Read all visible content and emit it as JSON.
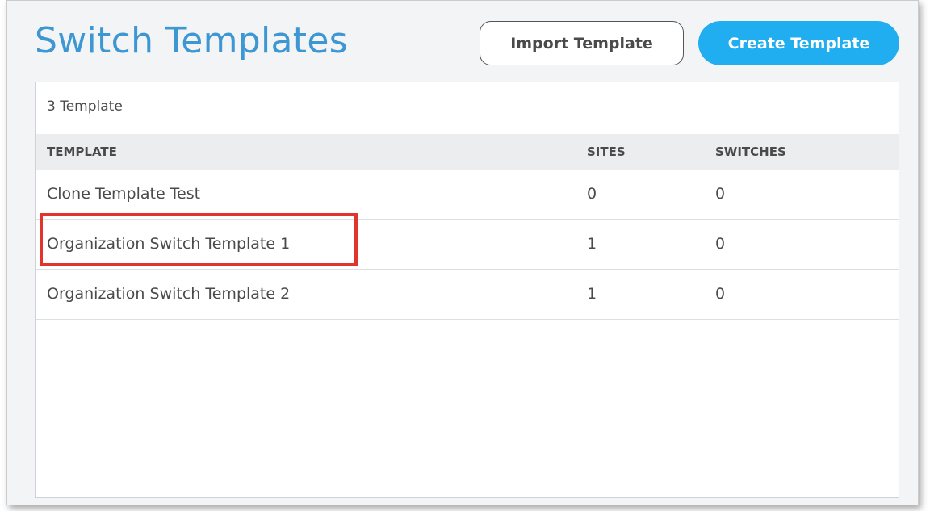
{
  "header": {
    "title": "Switch Templates",
    "import_label": "Import Template",
    "create_label": "Create Template"
  },
  "panel": {
    "count_text": "3 Template",
    "columns": {
      "template": "TEMPLATE",
      "sites": "SITES",
      "switches": "SWITCHES"
    },
    "rows": [
      {
        "template": "Clone Template Test",
        "sites": "0",
        "switches": "0"
      },
      {
        "template": "Organization Switch Template 1",
        "sites": "1",
        "switches": "0"
      },
      {
        "template": "Organization Switch Template 2",
        "sites": "1",
        "switches": "0"
      }
    ]
  },
  "colors": {
    "title": "#3d97d3",
    "primary_button": "#21aef0",
    "highlight_box": "#e0342c",
    "table_header_bg": "#ebedef"
  }
}
